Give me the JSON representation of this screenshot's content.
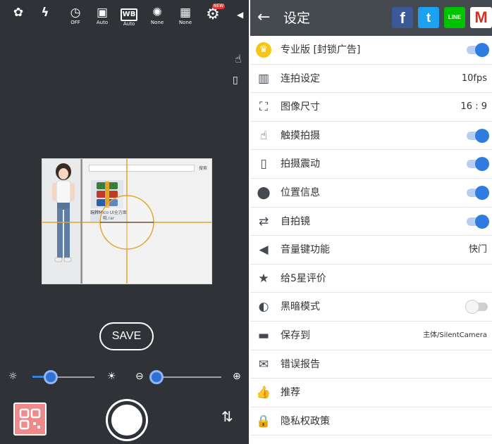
{
  "camera": {
    "top_icons": [
      {
        "icon": "macro-flower-icon",
        "glyph": "✿",
        "caption": ""
      },
      {
        "icon": "flash-off-icon",
        "glyph": "ϟ",
        "caption": ""
      },
      {
        "icon": "timer-off-icon",
        "glyph": "◷",
        "caption": "OFF"
      },
      {
        "icon": "scene-icon",
        "glyph": "▣",
        "caption": "Auto"
      },
      {
        "icon": "white-balance-icon",
        "glyph": "WB",
        "caption": "Auto"
      },
      {
        "icon": "filter-icon",
        "glyph": "✺",
        "caption": "None"
      },
      {
        "icon": "grid-icon",
        "glyph": "▦",
        "caption": "None"
      },
      {
        "icon": "settings-gear-icon",
        "glyph": "⚙",
        "caption": ""
      }
    ],
    "new_badge": "NEW",
    "collapse_glyph": "◀",
    "preview": {
      "search_text": "搜索",
      "file_label": "玩转Mico UI全方面哦.rar"
    },
    "save_label": "SAVE",
    "exposure_level": 0.3,
    "zoom_level": 0.08
  },
  "settings": {
    "title": "设定",
    "back_glyph": "←",
    "social": {
      "facebook": "f",
      "twitter": "t",
      "line": "LINE",
      "gmail": "M"
    },
    "items": [
      {
        "key": "pro",
        "label": "专业版 [封锁广告]",
        "icon": "crown-icon",
        "glyph": "♛",
        "type": "toggle",
        "on": true
      },
      {
        "key": "burst",
        "label": "连拍设定",
        "icon": "burst-icon",
        "glyph": "▥",
        "type": "value",
        "value": "10fps"
      },
      {
        "key": "size",
        "label": "图像尺寸",
        "icon": "image-size-icon",
        "glyph": "⛶",
        "type": "value",
        "value": "16 : 9"
      },
      {
        "key": "touch",
        "label": "触摸拍摄",
        "icon": "touch-icon",
        "glyph": "☝",
        "type": "toggle",
        "on": true
      },
      {
        "key": "vibrate",
        "label": "拍摄震动",
        "icon": "vibrate-icon",
        "glyph": "▯",
        "type": "toggle",
        "on": true
      },
      {
        "key": "location",
        "label": "位置信息",
        "icon": "location-icon",
        "glyph": "⬤",
        "type": "toggle",
        "on": true
      },
      {
        "key": "selfie",
        "label": "自拍镜",
        "icon": "selfie-flip-icon",
        "glyph": "⇄",
        "type": "toggle",
        "on": true
      },
      {
        "key": "volume",
        "label": "音量键功能",
        "icon": "volume-icon",
        "glyph": "◀",
        "type": "value",
        "value": "快门"
      },
      {
        "key": "rate",
        "label": "给5星评价",
        "icon": "star-icon",
        "glyph": "★",
        "type": "none"
      },
      {
        "key": "dark",
        "label": "黑暗模式",
        "icon": "dark-mode-icon",
        "glyph": "◐",
        "type": "toggle",
        "on": false
      },
      {
        "key": "save",
        "label": "保存到",
        "icon": "folder-icon",
        "glyph": "▬",
        "type": "value_small",
        "value": "主体/SilentCamera"
      },
      {
        "key": "report",
        "label": "错误报告",
        "icon": "mail-icon",
        "glyph": "✉",
        "type": "none"
      },
      {
        "key": "recommend",
        "label": "推荐",
        "icon": "thumbs-up-icon",
        "glyph": "👍",
        "type": "none"
      },
      {
        "key": "privacy",
        "label": "隐私权政策",
        "icon": "lock-icon",
        "glyph": "🔒",
        "type": "none"
      }
    ]
  }
}
